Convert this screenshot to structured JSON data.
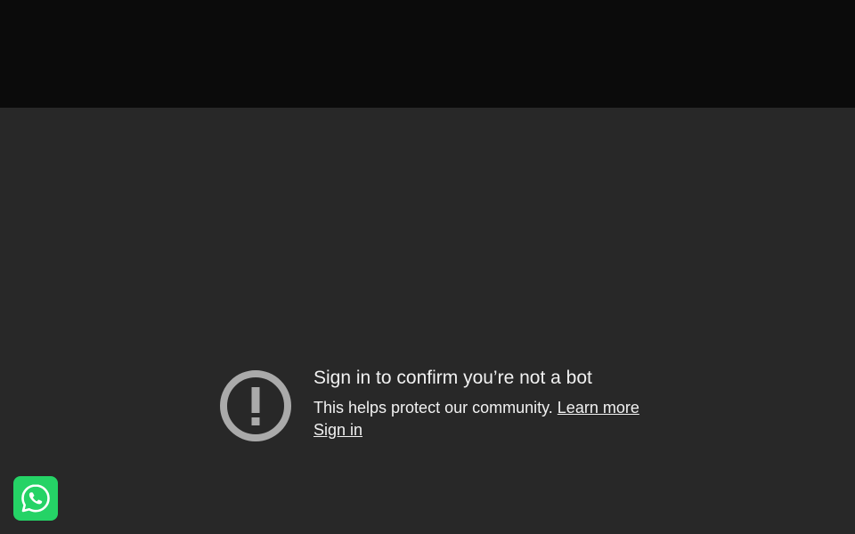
{
  "notice": {
    "title": "Sign in to confirm you’re not a bot",
    "description": "This helps protect our community.",
    "learn_more_label": "Learn more",
    "sign_in_label": "Sign in"
  },
  "icons": {
    "alert": "exclamation-circle-icon",
    "chat": "whatsapp-icon"
  },
  "colors": {
    "top_bar": "#0b0b0b",
    "background": "#282828",
    "text": "#f1f1f1",
    "icon": "#aaaaaa",
    "whatsapp": "#25d366"
  }
}
